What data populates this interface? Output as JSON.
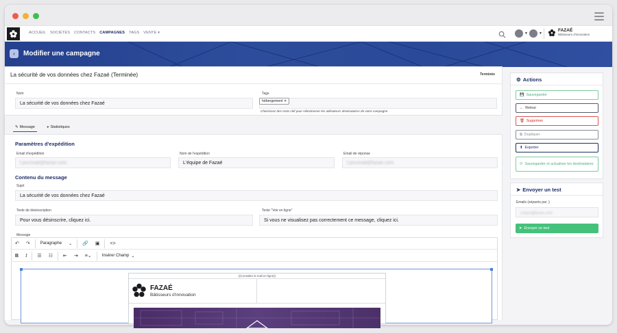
{
  "nav": {
    "items": [
      "ACCUEIL",
      "SOCIÉTÉS",
      "CONTACTS",
      "CAMPAGNES",
      "TAGS",
      "VENTE ▾"
    ],
    "active": "CAMPAGNES",
    "brand_name": "FAZAÉ",
    "brand_sub": "Bâtisseurs d'innovation"
  },
  "banner": {
    "title": "Modifier une campagne"
  },
  "campaign": {
    "header_title": "La sécurité de vos données chez Fazaé (Terminée)",
    "status": "Terminée",
    "name_label": "Nom",
    "name_value": "La sécurité de vos données chez Fazaé",
    "tags_label": "Tags",
    "tag": "hébergement",
    "tags_hint": "Choisissez des mots clef pour sélectionner les utilisateurs destinataires de votre campagne"
  },
  "tabs": [
    "Message",
    "Statistiques"
  ],
  "expedition": {
    "title": "Paramètres d'expédition",
    "email_label": "Email d'expédition",
    "email_value": "f.piccinali@fazae.com",
    "name_label": "Nom de l'expédition",
    "name_value": "L'équipe de Fazaé",
    "reply_label": "Email de réponse",
    "reply_value": "f.piccinali@fazae.com"
  },
  "content": {
    "title": "Contenu du message",
    "subject_label": "Sujet",
    "subject_value": "La sécurité de vos données chez Fazaé",
    "unsub_label": "Texte de désinscription",
    "unsub_value": "Pour vous désinscrire, cliquez ici.",
    "online_label": "Texte \"Voir en ligne\"",
    "online_value": "Si vous ne visualisez pas correctement ce message, cliquez ici.",
    "message_label": "Message"
  },
  "editor": {
    "paragraph": "Paragraphe",
    "insert_field": "Insérer Champ",
    "consult_online": "((Consulter le mail en ligne))",
    "email_brand": "FAZAÉ",
    "email_brand_sub": "Bâtisseurs d'innovation"
  },
  "actions": {
    "title": "Actions",
    "save": "Sauvegarder",
    "back": "Retour",
    "delete": "Supprimer",
    "duplicate": "Dupliquer",
    "export": "Exporter",
    "save_refresh": "Sauvegarder et actualiser les destinataires"
  },
  "test": {
    "title": "Envoyer un test",
    "emails_label": "Emails (séparés par ;)",
    "emails_value": "y.bayn@fazae.com",
    "send": "Envoyer un test"
  },
  "colors": {
    "navy": "#1d2c66",
    "banner": "#2a4a99",
    "green": "#45c17c",
    "red": "#d9534f"
  }
}
